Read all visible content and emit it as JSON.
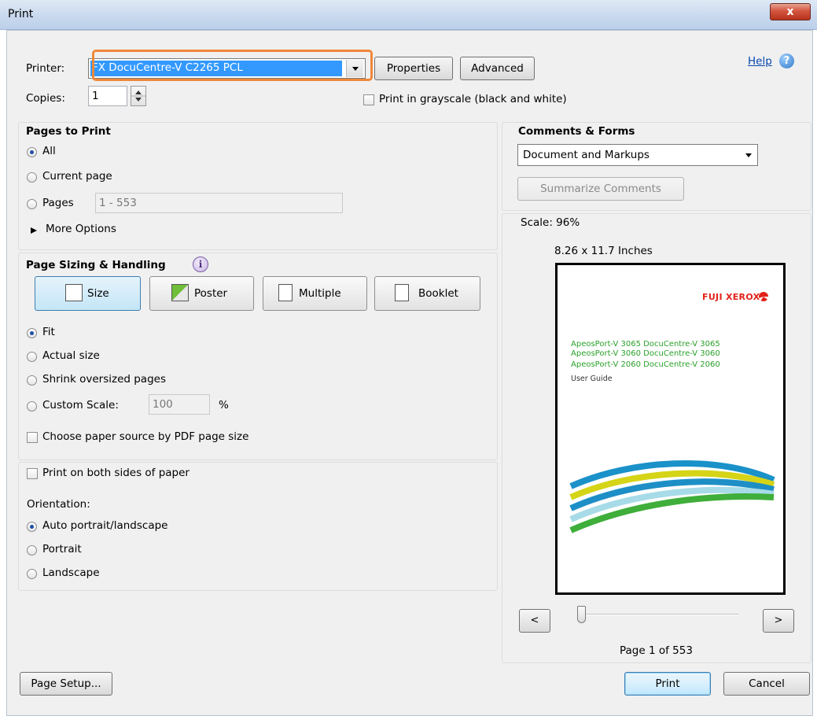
{
  "window": {
    "title": "Print",
    "close_label": "x"
  },
  "printer": {
    "label": "Printer:",
    "selected": "FX DocuCentre-V C2265 PCL",
    "properties_label": "Properties",
    "advanced_label": "Advanced",
    "help_label": "Help"
  },
  "copies": {
    "label": "Copies:",
    "value": "1"
  },
  "grayscale": {
    "label": "Print in grayscale (black and white)",
    "checked": false
  },
  "pages_to_print": {
    "title": "Pages to Print",
    "all_label": "All",
    "current_label": "Current page",
    "pages_label": "Pages",
    "pages_value": "1 - 553",
    "more_options_label": "More Options",
    "selected": "all"
  },
  "sizing": {
    "title": "Page Sizing & Handling",
    "size_label": "Size",
    "poster_label": "Poster",
    "multiple_label": "Multiple",
    "booklet_label": "Booklet",
    "fit_label": "Fit",
    "actual_label": "Actual size",
    "shrink_label": "Shrink oversized pages",
    "custom_label": "Custom Scale:",
    "custom_value": "100",
    "percent": "%",
    "paper_source_label": "Choose paper source by PDF page size",
    "selected": "fit"
  },
  "duplex": {
    "label": "Print on both sides of paper",
    "checked": false
  },
  "orientation": {
    "label": "Orientation:",
    "auto_label": "Auto portrait/landscape",
    "portrait_label": "Portrait",
    "landscape_label": "Landscape",
    "selected": "auto"
  },
  "comments_forms": {
    "title": "Comments & Forms",
    "selected": "Document and Markups",
    "summarize_label": "Summarize Comments"
  },
  "preview": {
    "scale": "Scale: 96%",
    "dimensions": "8.26 x 11.7 Inches",
    "brand": "FUJI xerox",
    "line1": "ApeosPort-V 3065 DocuCentre-V 3065",
    "line2": "ApeosPort-V 3060 DocuCentre-V 3060",
    "line3": "ApeosPort-V 2060 DocuCentre-V 2060",
    "subtitle": "User Guide",
    "prev_label": "<",
    "next_label": ">",
    "page_indicator": "Page 1 of 553",
    "slider_position": 0
  },
  "footer": {
    "page_setup_label": "Page Setup...",
    "print_label": "Print",
    "cancel_label": "Cancel"
  },
  "colors": {
    "highlight_outline": "#f0883a",
    "selection_blue": "#3399ff",
    "brand_red": "#e2231a",
    "model_green": "#2aa02a"
  }
}
